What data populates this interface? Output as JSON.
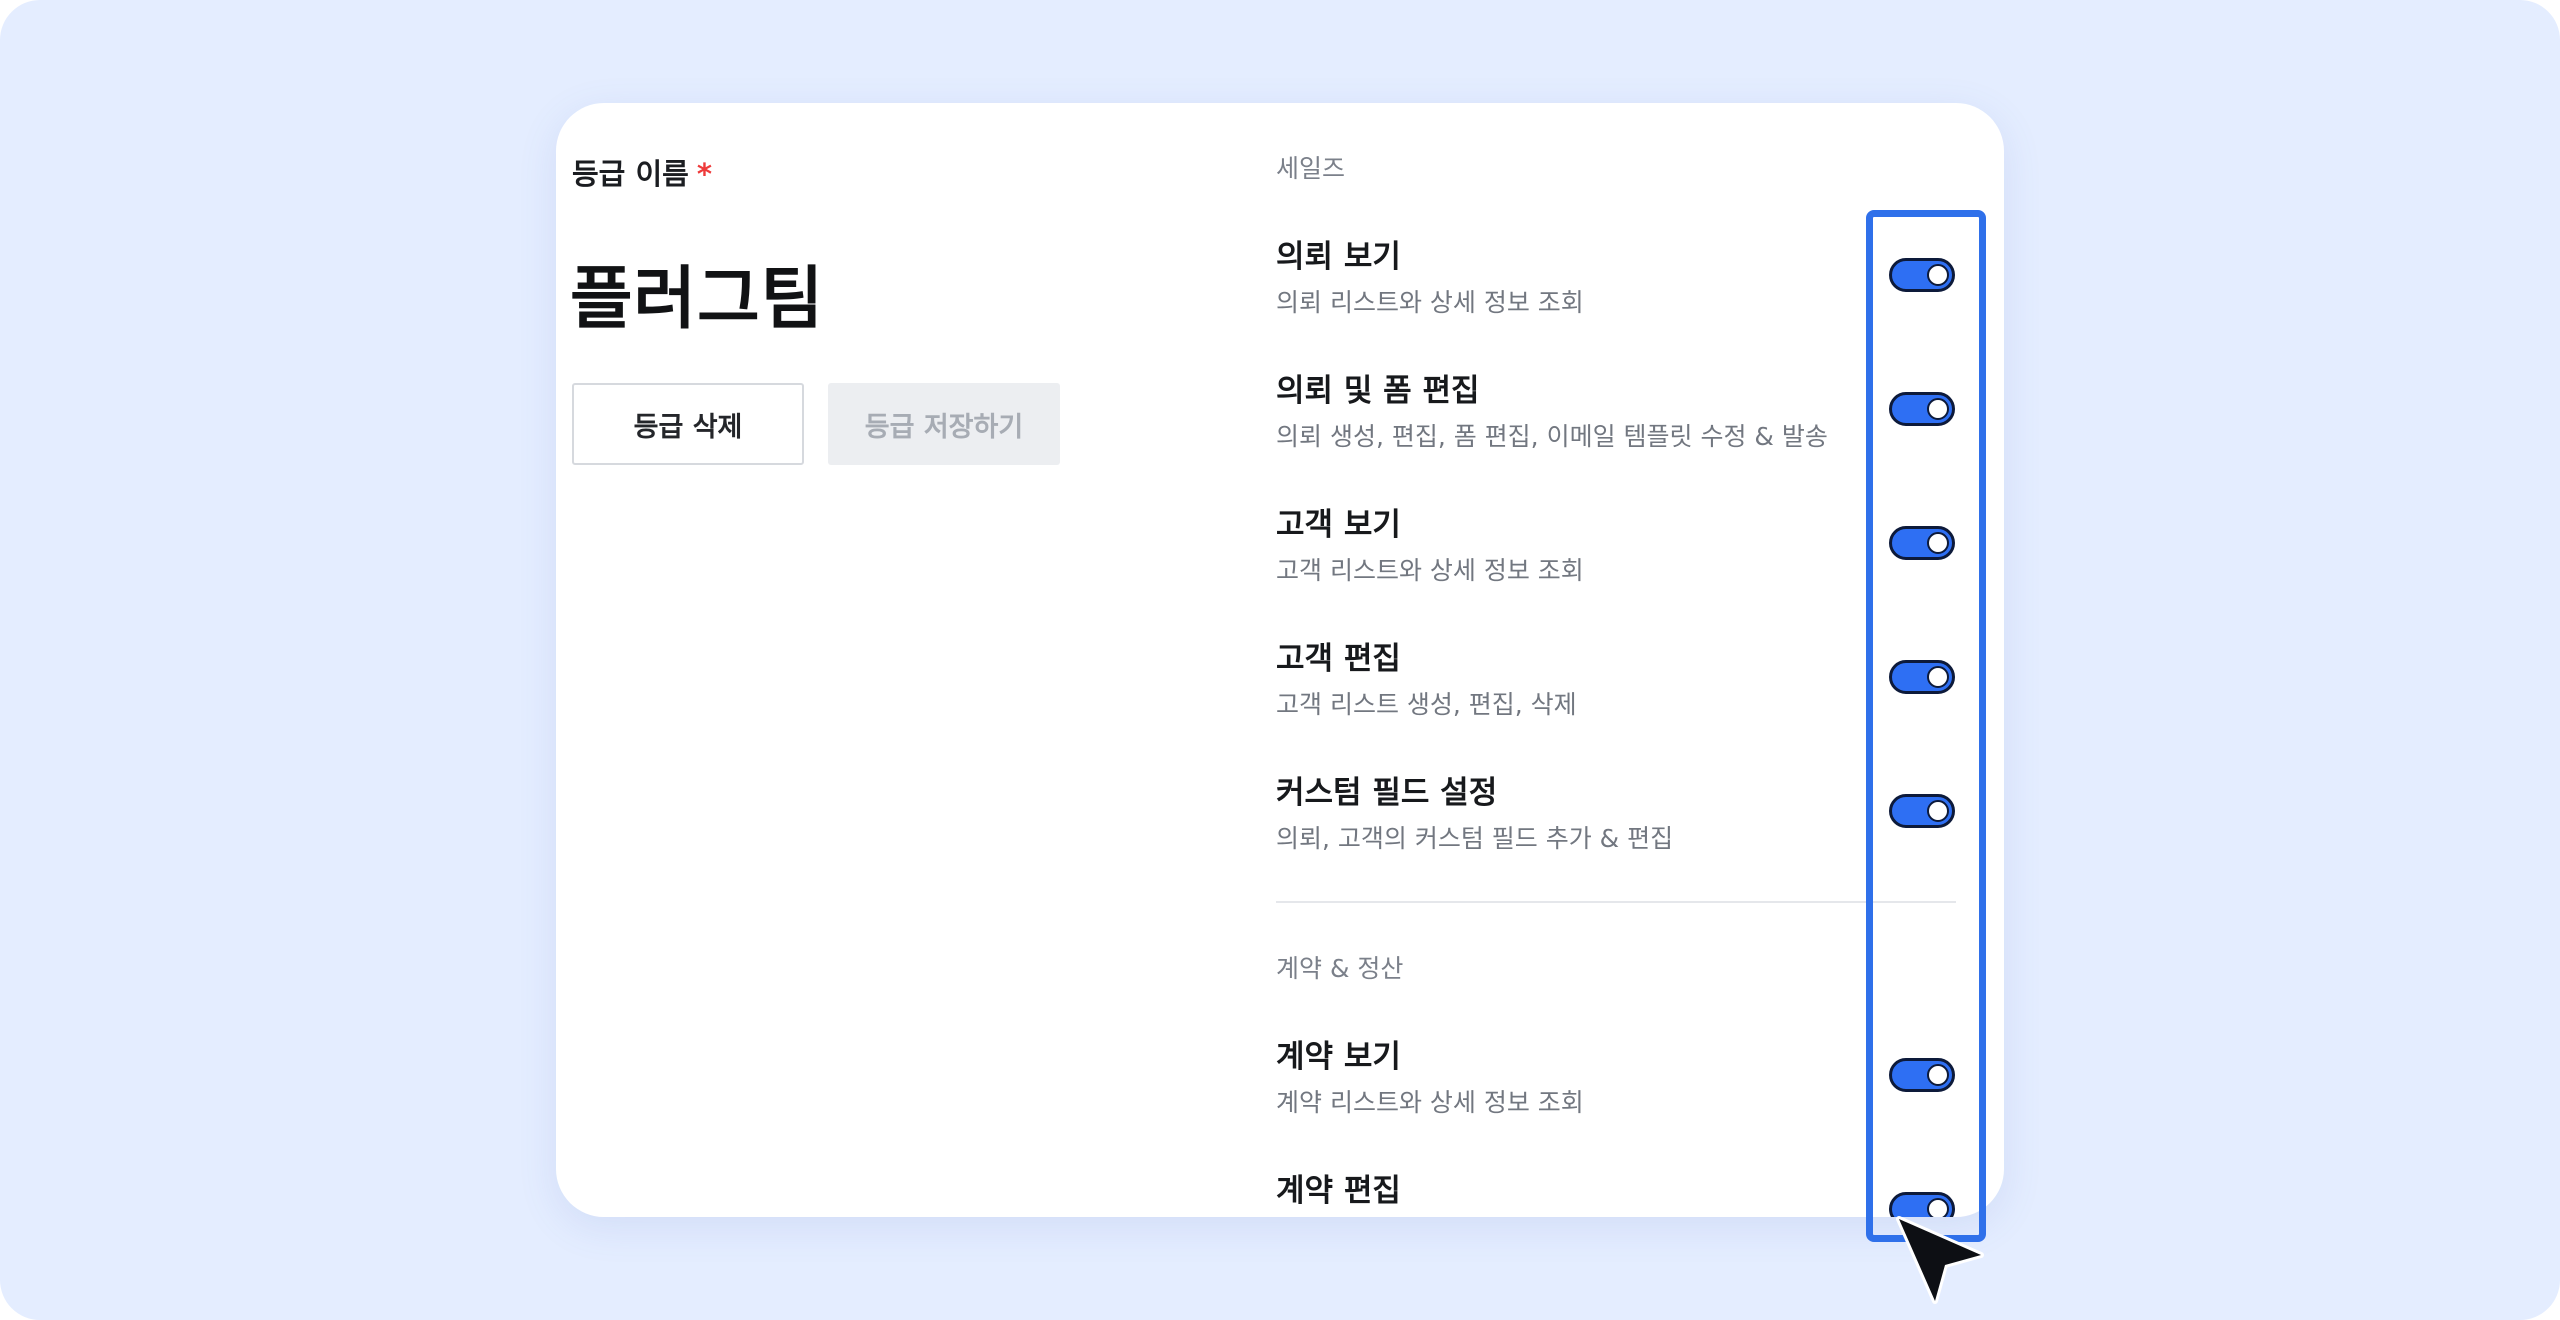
{
  "grade": {
    "label": "등급 이름",
    "required_mark": "*",
    "name": "플러그팀",
    "delete_button": "등급 삭제",
    "save_button": "등급 저장하기"
  },
  "sections": [
    {
      "title": "세일즈",
      "items": [
        {
          "name": "의뢰 보기",
          "desc": "의뢰 리스트와 상세 정보 조회",
          "enabled": true
        },
        {
          "name": "의뢰 및 폼 편집",
          "desc": "의뢰 생성, 편집, 폼 편집, 이메일 템플릿 수정 & 발송",
          "enabled": true
        },
        {
          "name": "고객 보기",
          "desc": "고객 리스트와 상세 정보 조회",
          "enabled": true
        },
        {
          "name": "고객 편집",
          "desc": "고객 리스트 생성, 편집, 삭제",
          "enabled": true
        },
        {
          "name": "커스텀 필드 설정",
          "desc": "의뢰, 고객의 커스텀 필드 추가 & 편집",
          "enabled": true
        }
      ]
    },
    {
      "title": "계약 & 정산",
      "items": [
        {
          "name": "계약 보기",
          "desc": "계약 리스트와 상세 정보 조회",
          "enabled": true
        },
        {
          "name": "계약 편집",
          "desc": "",
          "enabled": true
        }
      ]
    }
  ],
  "colors": {
    "background": "#e4edff",
    "accent": "#2e6ff3",
    "highlight": "#2f70ea",
    "required": "#ee3b3b"
  },
  "icons": {
    "pointer": "cursor-arrow-icon"
  }
}
